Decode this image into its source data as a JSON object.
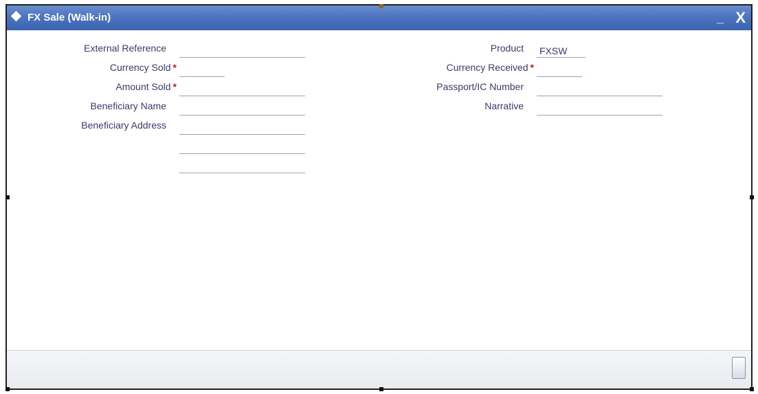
{
  "window": {
    "title": "FX Sale (Walk-in)",
    "minimize_label": "_",
    "close_label": "X"
  },
  "form": {
    "external_reference": {
      "label": "External Reference",
      "value": ""
    },
    "currency_sold": {
      "label": "Currency Sold",
      "required_mark": "*",
      "value": ""
    },
    "amount_sold": {
      "label": "Amount Sold",
      "required_mark": "*",
      "value": ""
    },
    "beneficiary_name": {
      "label": "Beneficiary Name",
      "value": ""
    },
    "beneficiary_address": {
      "label": "Beneficiary Address",
      "lines": [
        "",
        "",
        ""
      ]
    },
    "product": {
      "label": "Product",
      "value": "FXSW"
    },
    "currency_received": {
      "label": "Currency Received",
      "required_mark": "*",
      "value": ""
    },
    "passport_ic_number": {
      "label": "Passport/IC Number",
      "value": ""
    },
    "narrative": {
      "label": "Narrative",
      "value": ""
    }
  },
  "colors": {
    "titlebar": "#4d74bf",
    "label_text": "#3a3a6a",
    "required_mark": "#c81818"
  }
}
